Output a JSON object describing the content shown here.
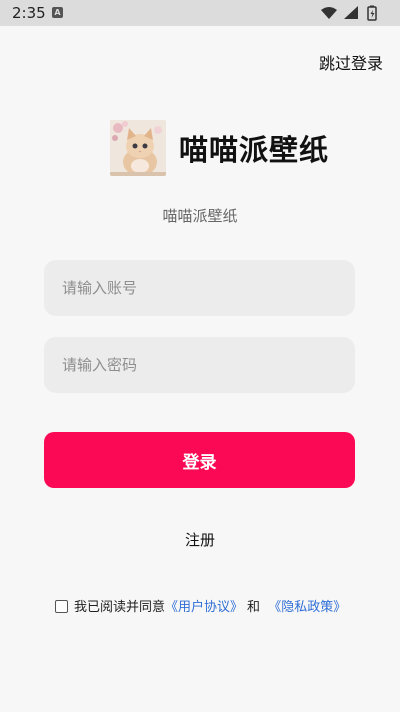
{
  "status_bar": {
    "time": "2:35",
    "app_badge": "A"
  },
  "header": {
    "skip_label": "跳过登录"
  },
  "brand": {
    "title": "喵喵派壁纸",
    "subtitle": "喵喵派壁纸"
  },
  "form": {
    "account_placeholder": "请输入账号",
    "password_placeholder": "请输入密码",
    "account_value": "",
    "password_value": "",
    "login_label": "登录",
    "register_label": "注册"
  },
  "agreement": {
    "prefix": "我已阅读并同意",
    "user_agreement": "《用户协议》",
    "and": "和",
    "privacy_policy": "《隐私政策》"
  },
  "colors": {
    "primary": "#fb0954",
    "link": "#2f6fd6",
    "background": "#f7f7f7",
    "input_bg": "#ececec"
  }
}
